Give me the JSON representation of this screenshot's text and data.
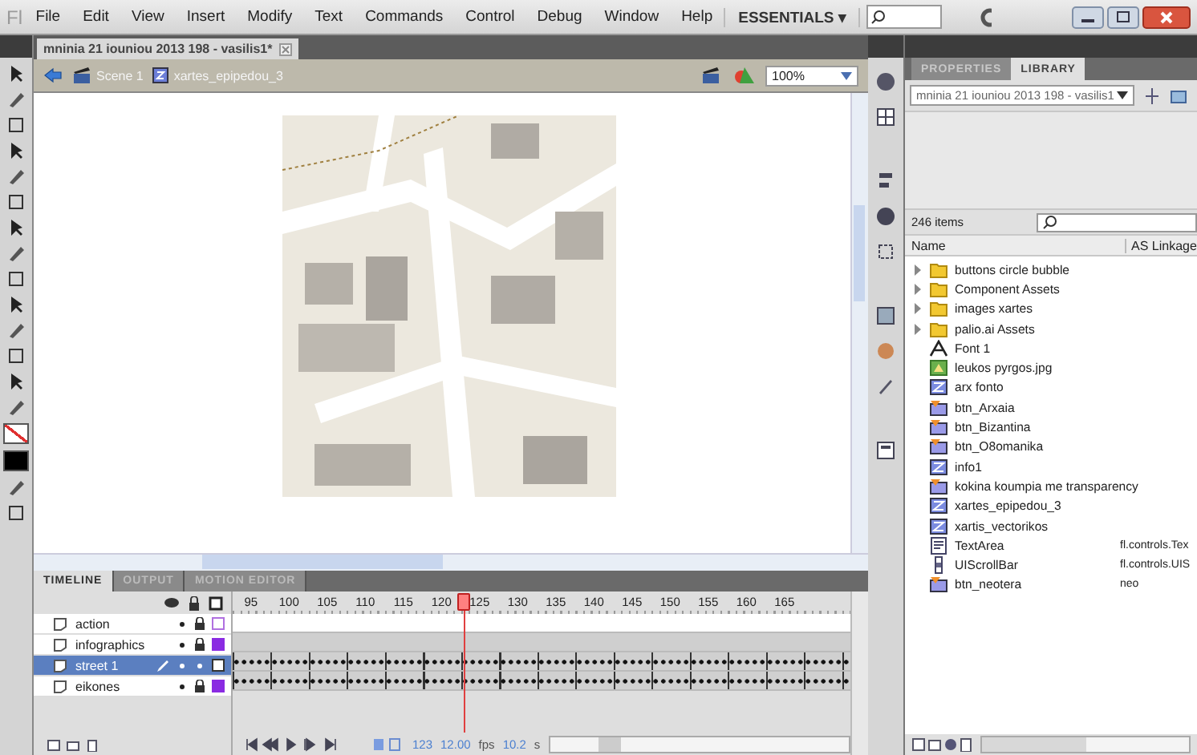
{
  "menu_bar": {
    "logo": "Fl",
    "items": [
      "File",
      "Edit",
      "View",
      "Insert",
      "Modify",
      "Text",
      "Commands",
      "Control",
      "Debug",
      "Window",
      "Help"
    ],
    "workspace": "ESSENTIALS",
    "workspace_caret": "▾"
  },
  "document": {
    "tab": "mninia 21 iouniou 2013 198 - vasilis1*",
    "breadcrumbs": [
      "Scene 1",
      "xartes_epipedou_3"
    ],
    "zoom": "100%"
  },
  "timeline": {
    "tabs": [
      {
        "label": "TIMELINE",
        "selected": true
      },
      {
        "label": "OUTPUT",
        "selected": false
      },
      {
        "label": "MOTION EDITOR",
        "selected": false
      }
    ],
    "ruler": [
      "95",
      "100",
      "105",
      "110",
      "115",
      "120",
      "125",
      "130",
      "135",
      "140",
      "145",
      "150",
      "155",
      "160",
      "165"
    ],
    "layers": [
      {
        "name": "action",
        "selected": false,
        "locked": true,
        "outline": true,
        "color": "#b070e0",
        "kind": "blank"
      },
      {
        "name": "infographics",
        "selected": false,
        "locked": true,
        "outline": false,
        "color": "#8a2be2",
        "kind": "empty"
      },
      {
        "name": "street 1",
        "selected": true,
        "locked": false,
        "outline": true,
        "color": "#333333",
        "kind": "keyframes"
      },
      {
        "name": "eikones",
        "selected": false,
        "locked": true,
        "outline": false,
        "color": "#8a2be2",
        "kind": "keyframes"
      }
    ],
    "current_frame": "123",
    "fps": "12.00",
    "fps_unit": "fps",
    "time": "10.2",
    "time_unit": "s"
  },
  "library": {
    "tabs": [
      {
        "label": "PROPERTIES",
        "selected": false
      },
      {
        "label": "LIBRARY",
        "selected": true
      }
    ],
    "document": "mninia 21 iouniou 2013 198 - vasilis1",
    "count": "246 items",
    "columns": [
      "Name",
      "AS Linkage"
    ],
    "items": [
      {
        "kind": "folder",
        "name": "buttons circle bubble",
        "expanded": false
      },
      {
        "kind": "folder",
        "name": "Component Assets",
        "expanded": false
      },
      {
        "kind": "folder",
        "name": "images xartes",
        "expanded": false
      },
      {
        "kind": "folder",
        "name": "palio.ai Assets",
        "expanded": false
      },
      {
        "kind": "font",
        "name": "Font 1"
      },
      {
        "kind": "bitmap",
        "name": "leukos pyrgos.jpg"
      },
      {
        "kind": "movieclip",
        "name": "arx fonto"
      },
      {
        "kind": "button",
        "name": "btn_Arxaia"
      },
      {
        "kind": "button",
        "name": "btn_Bizantina"
      },
      {
        "kind": "button",
        "name": "btn_O8omanika"
      },
      {
        "kind": "movieclip",
        "name": "info1"
      },
      {
        "kind": "button",
        "name": "kokina koumpia me transparency"
      },
      {
        "kind": "movieclip",
        "name": "xartes_epipedou_3"
      },
      {
        "kind": "movieclip",
        "name": "xartis_vectorikos"
      },
      {
        "kind": "component",
        "name": "TextArea",
        "linkage": "fl.controls.Tex"
      },
      {
        "kind": "scrollbar",
        "name": "UIScrollBar",
        "linkage": "fl.controls.UIS"
      },
      {
        "kind": "button",
        "name": "btn_neotera",
        "linkage": "neo"
      }
    ]
  }
}
